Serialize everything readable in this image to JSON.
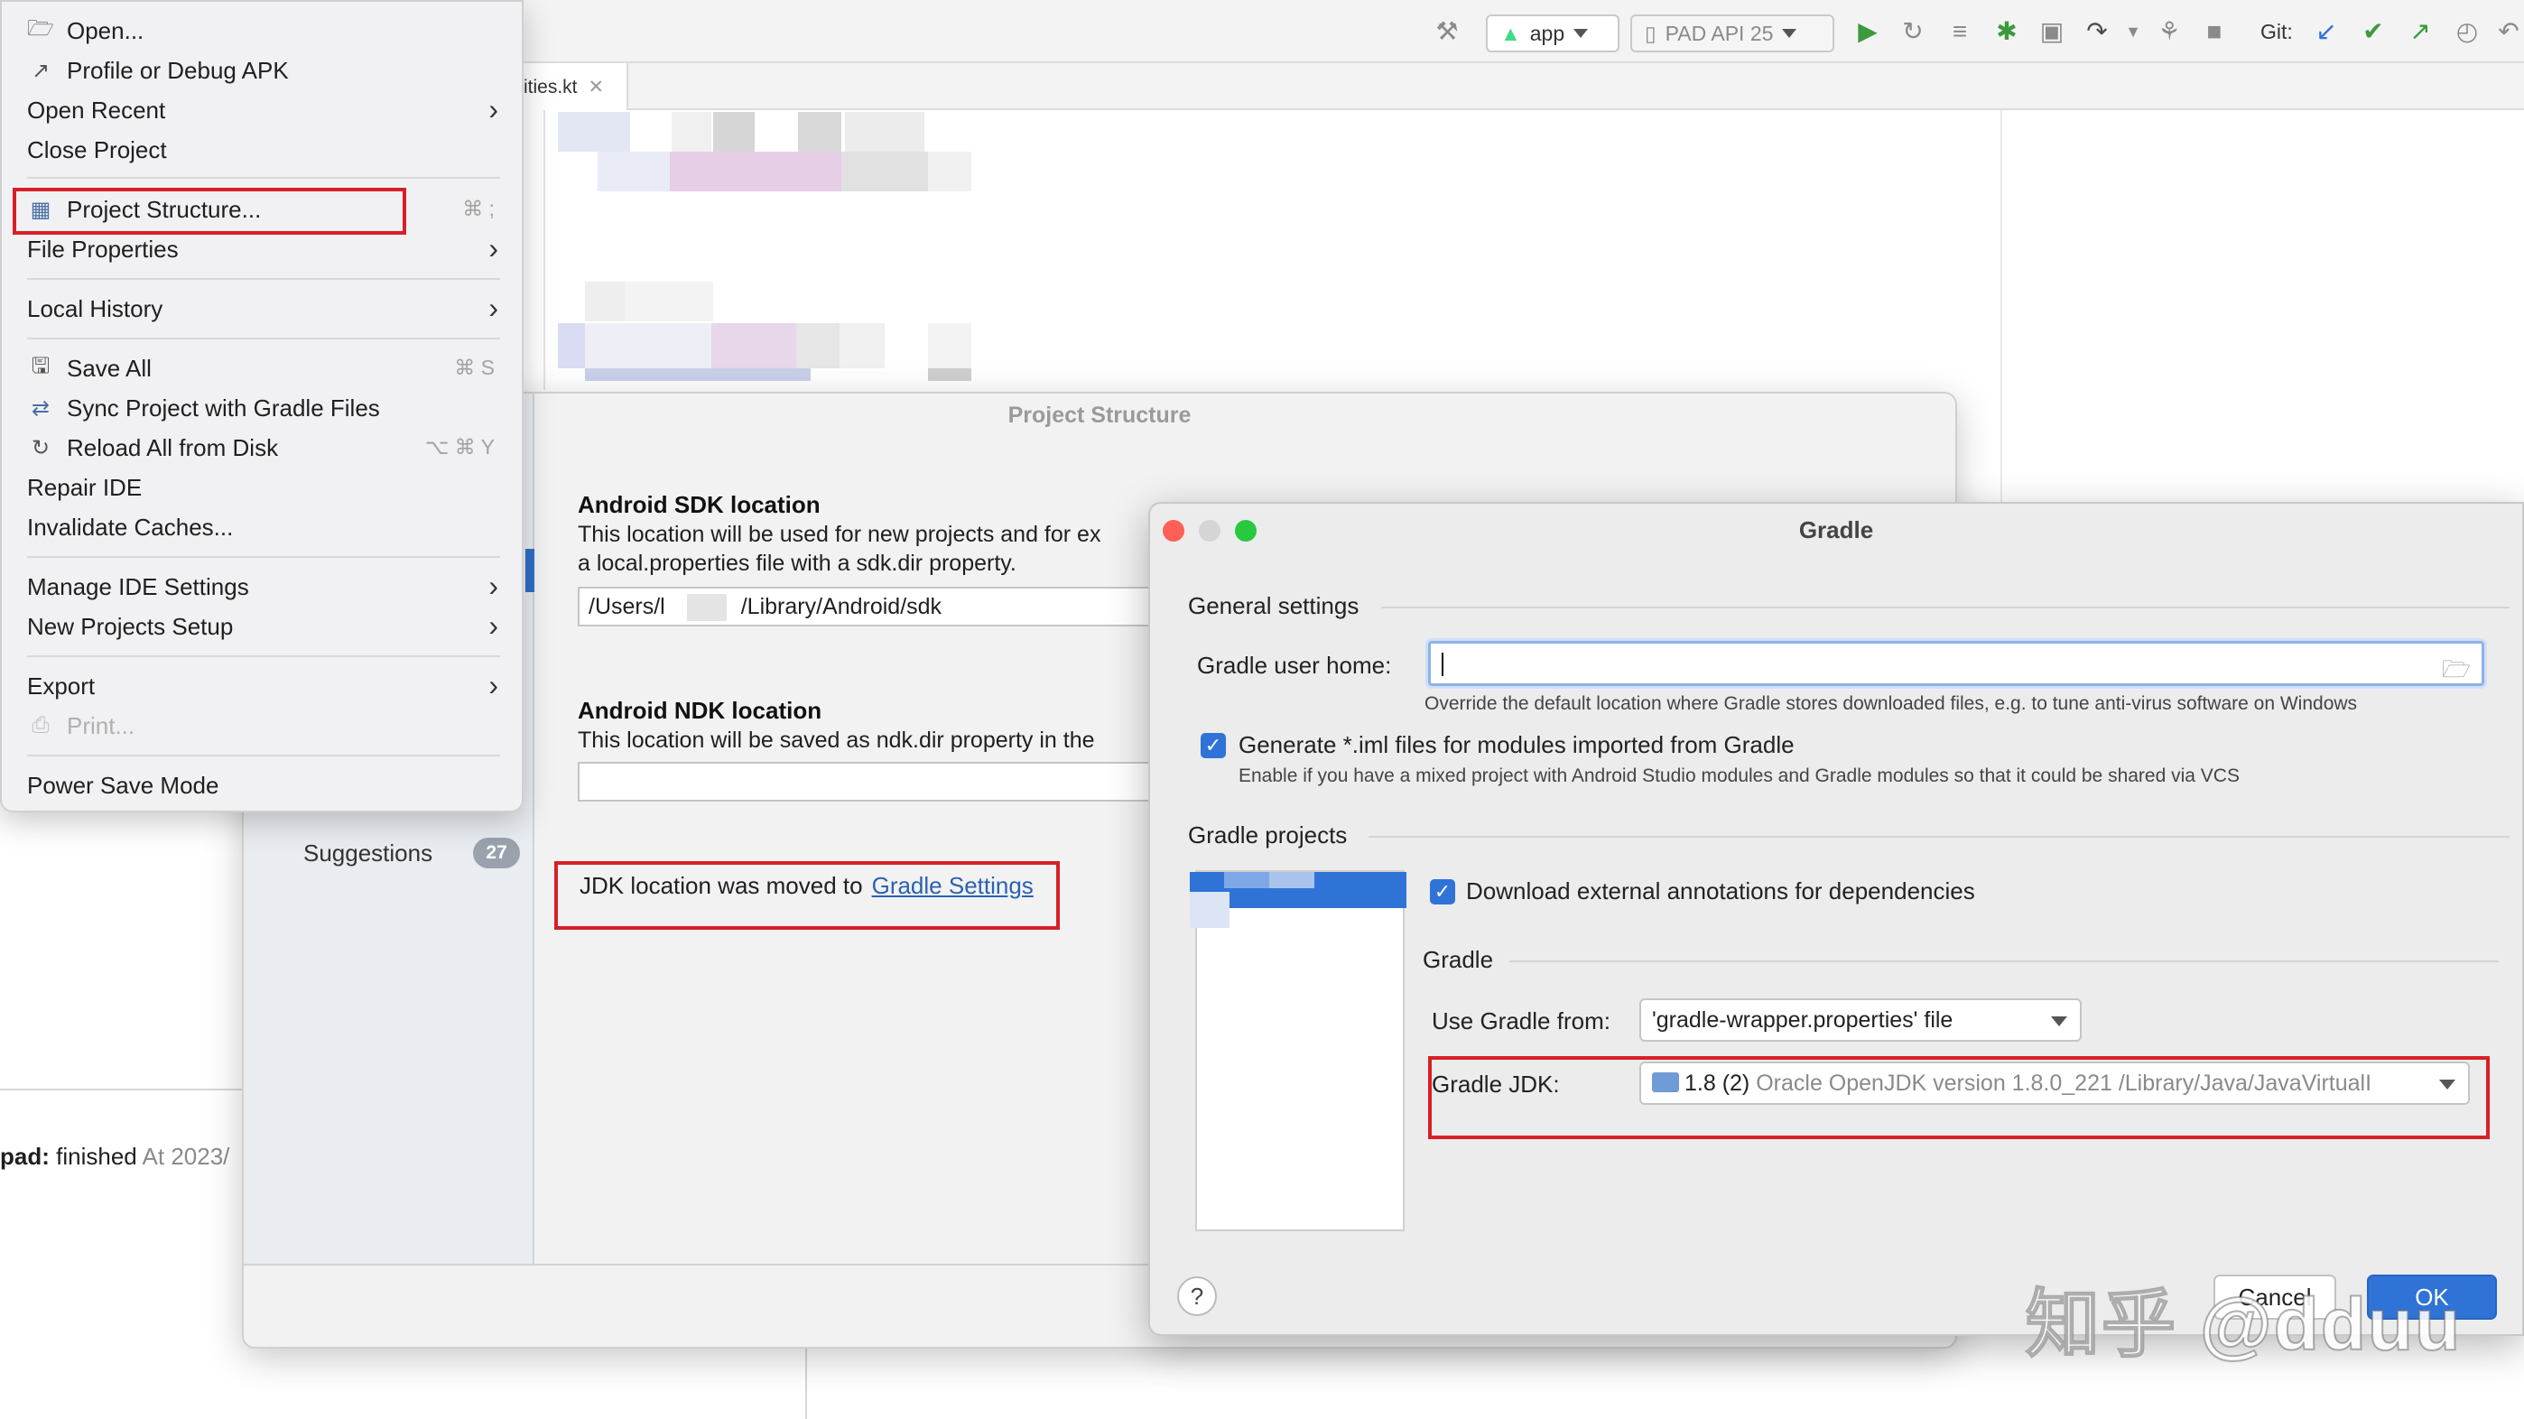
{
  "toolbar": {
    "run_config": "app",
    "device": "PAD API 25",
    "git_label": "Git:"
  },
  "editor": {
    "tab_label": "ities.kt"
  },
  "file_menu": {
    "items": [
      {
        "label": "Open...",
        "icon": "folder-icon"
      },
      {
        "label": "Profile or Debug APK",
        "icon": "profile-icon"
      },
      {
        "label": "Open Recent",
        "submenu": true
      },
      {
        "label": "Close Project"
      },
      {
        "label": "Project Structure...",
        "icon": "project-structure-icon",
        "shortcut": "⌘ ;"
      },
      {
        "label": "File Properties",
        "submenu": true
      },
      {
        "label": "Local History",
        "submenu": true
      },
      {
        "label": "Save All",
        "icon": "save-icon",
        "shortcut": "⌘ S"
      },
      {
        "label": "Sync Project with Gradle Files",
        "icon": "gradle-sync-icon"
      },
      {
        "label": "Reload All from Disk",
        "icon": "reload-icon",
        "shortcut": "⌥ ⌘ Y"
      },
      {
        "label": "Repair IDE"
      },
      {
        "label": "Invalidate Caches..."
      },
      {
        "label": "Manage IDE Settings",
        "submenu": true
      },
      {
        "label": "New Projects Setup",
        "submenu": true
      },
      {
        "label": "Export",
        "submenu": true
      },
      {
        "label": "Print...",
        "icon": "print-icon",
        "disabled": true
      },
      {
        "label": "Power Save Mode"
      }
    ]
  },
  "run_status": {
    "task": "pad:",
    "state": "finished",
    "time": "At 2023/"
  },
  "project_structure": {
    "title": "Project Structure",
    "suggestions_label": "Suggestions",
    "suggestions_count": "27",
    "sdk_heading": "Android SDK location",
    "sdk_desc_1": "This location will be used for new projects and for ex",
    "sdk_desc_2": "a local.properties file with a sdk.dir property.",
    "sdk_path_prefix": "/Users/l",
    "sdk_path_suffix": "/Library/Android/sdk",
    "ndk_heading": "Android NDK location",
    "ndk_desc": "This location will be saved as ndk.dir property in the",
    "ndk_path": "",
    "jdk_note": "JDK location was moved to",
    "jdk_link": "Gradle Settings"
  },
  "gradle_dialog": {
    "title": "Gradle",
    "general_settings": "General settings",
    "user_home_label": "Gradle user home:",
    "user_home_value": "",
    "user_home_hint": "Override the default location where Gradle stores downloaded files, e.g. to tune anti-virus software on Windows",
    "generate_iml_label": "Generate *.iml files for modules imported from Gradle",
    "generate_iml_checked": true,
    "generate_iml_hint": "Enable if you have a mixed project with Android Studio modules and Gradle modules so that it could be shared via VCS",
    "gradle_projects": "Gradle projects",
    "download_annotations_label": "Download external annotations for dependencies",
    "download_annotations_checked": true,
    "gradle_section": "Gradle",
    "use_gradle_from_label": "Use Gradle from:",
    "use_gradle_from_value": "'gradle-wrapper.properties' file",
    "gradle_jdk_label": "Gradle JDK:",
    "gradle_jdk_version": "1.8 (2)",
    "gradle_jdk_detail": "Oracle OpenJDK version 1.8.0_221 /Library/Java/JavaVirtualI",
    "help": "?",
    "cancel": "Cancel",
    "ok": "OK"
  },
  "watermark": "知乎 @dduu",
  "colors": {
    "accent": "#2f73d6",
    "highlight_box": "#d81f26",
    "link": "#2a62b0"
  }
}
